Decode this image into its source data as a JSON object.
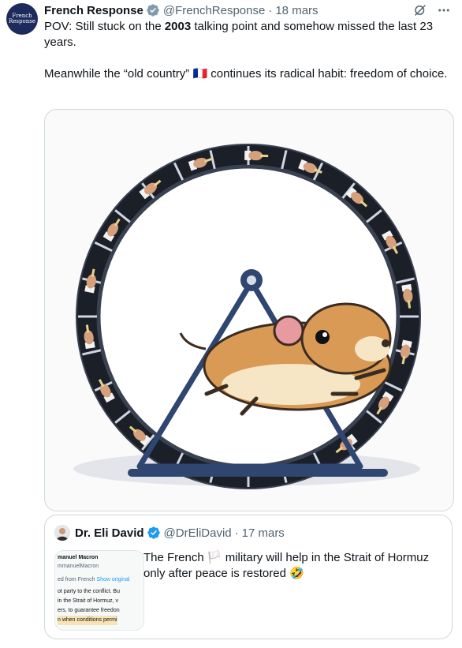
{
  "tweet": {
    "author_name": "French Response",
    "author_handle": "@FrenchResponse",
    "separator": "·",
    "date": "18 mars",
    "avatar_text_line1": "French",
    "avatar_text_line2": "Response",
    "text_line1_pre": "POV: Still stuck on the ",
    "text_line1_bold": "2003",
    "text_line1_post": " talking point and somehow missed the last 23 years.",
    "text_line2_pre": "Meanwhile the “old country” ",
    "text_line2_flag": "🇫🇷",
    "text_line2_post": " continues its radical habit: freedom of choice."
  },
  "quote": {
    "author_name": "Dr. Eli David",
    "author_handle": "@DrEliDavid",
    "separator": "·",
    "date": "17 mars",
    "text_pre": "The French ",
    "text_flag": "🏳️",
    "text_post": " military will help in the Strait of Hormuz only after peace is restored ",
    "text_emoji": "🤣",
    "thumb": {
      "line1": "manuel Macron",
      "line2": "mmanuelMacron",
      "line3_a": "ed from French",
      "line3_b": "Show original",
      "line4": "ot party to the conflict. Bu",
      "line5": "in the Strait of Hormuz, v",
      "line6": "ers, to guarantee freedon",
      "line7": "n when conditions permi"
    }
  },
  "colors": {
    "brand_blue": "#1d9bf0",
    "muted": "#536471",
    "avatar_bg": "#1d2a5c"
  },
  "icons": [
    "verified-badge-icon",
    "grok-icon",
    "more-icon"
  ]
}
